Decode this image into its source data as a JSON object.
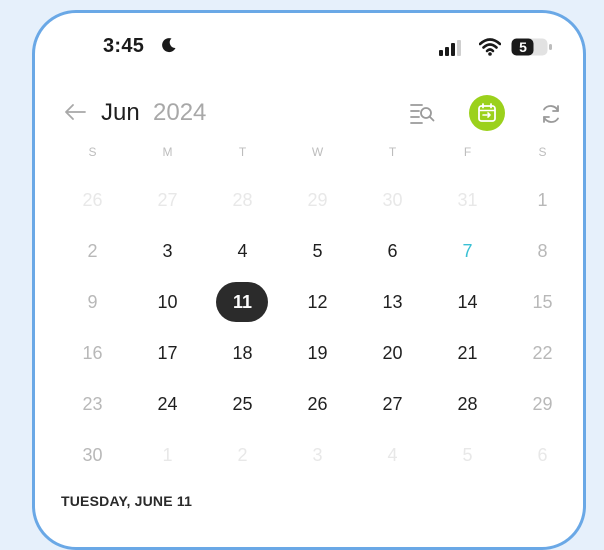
{
  "status": {
    "time": "3:45",
    "battery": "5"
  },
  "header": {
    "month": "Jun",
    "year": "2024"
  },
  "weekdays": [
    "S",
    "M",
    "T",
    "W",
    "T",
    "F",
    "S"
  ],
  "calendar": {
    "weeks": [
      [
        {
          "d": "26",
          "t": "other"
        },
        {
          "d": "27",
          "t": "other"
        },
        {
          "d": "28",
          "t": "other"
        },
        {
          "d": "29",
          "t": "other"
        },
        {
          "d": "30",
          "t": "other"
        },
        {
          "d": "31",
          "t": "other"
        },
        {
          "d": "1",
          "t": "weekend"
        }
      ],
      [
        {
          "d": "2",
          "t": "weekend"
        },
        {
          "d": "3",
          "t": "normal"
        },
        {
          "d": "4",
          "t": "normal"
        },
        {
          "d": "5",
          "t": "normal"
        },
        {
          "d": "6",
          "t": "normal"
        },
        {
          "d": "7",
          "t": "marked"
        },
        {
          "d": "8",
          "t": "weekend"
        }
      ],
      [
        {
          "d": "9",
          "t": "weekend"
        },
        {
          "d": "10",
          "t": "normal"
        },
        {
          "d": "11",
          "t": "selected"
        },
        {
          "d": "12",
          "t": "normal"
        },
        {
          "d": "13",
          "t": "normal"
        },
        {
          "d": "14",
          "t": "normal"
        },
        {
          "d": "15",
          "t": "weekend"
        }
      ],
      [
        {
          "d": "16",
          "t": "weekend"
        },
        {
          "d": "17",
          "t": "normal"
        },
        {
          "d": "18",
          "t": "normal"
        },
        {
          "d": "19",
          "t": "normal"
        },
        {
          "d": "20",
          "t": "normal"
        },
        {
          "d": "21",
          "t": "normal"
        },
        {
          "d": "22",
          "t": "weekend"
        }
      ],
      [
        {
          "d": "23",
          "t": "weekend"
        },
        {
          "d": "24",
          "t": "normal"
        },
        {
          "d": "25",
          "t": "normal"
        },
        {
          "d": "26",
          "t": "normal"
        },
        {
          "d": "27",
          "t": "normal"
        },
        {
          "d": "28",
          "t": "normal"
        },
        {
          "d": "29",
          "t": "weekend"
        }
      ],
      [
        {
          "d": "30",
          "t": "weekend"
        },
        {
          "d": "1",
          "t": "other"
        },
        {
          "d": "2",
          "t": "other"
        },
        {
          "d": "3",
          "t": "other"
        },
        {
          "d": "4",
          "t": "other"
        },
        {
          "d": "5",
          "t": "other"
        },
        {
          "d": "6",
          "t": "other"
        }
      ]
    ]
  },
  "selected_day_label": "TUESDAY, JUNE 11",
  "colors": {
    "accent_green": "#9bd11c",
    "selected_bg": "#2b2b2b",
    "marked_day": "#39c0d4",
    "frame_border": "#6aa8e6"
  },
  "icons": {
    "moon": "moon-icon",
    "signal": "cellular-signal-icon",
    "wifi": "wifi-icon",
    "battery": "battery-icon",
    "back": "arrow-left-icon",
    "filter": "search-filter-icon",
    "sync": "calendar-sync-icon",
    "refresh": "refresh-icon"
  }
}
